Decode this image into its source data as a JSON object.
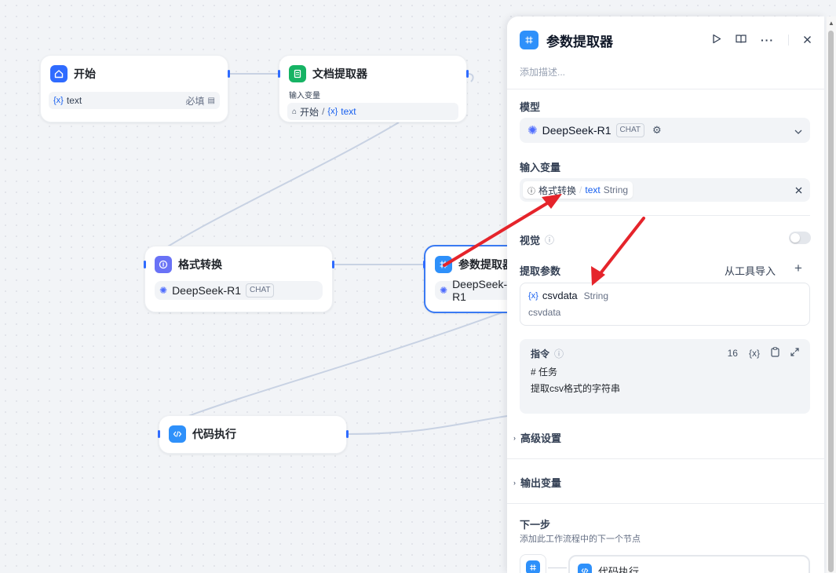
{
  "canvas": {
    "nodes": {
      "start": {
        "title": "开始",
        "var_prefix": "{x}",
        "var_name": "text",
        "required": "必填"
      },
      "doc_extractor": {
        "title": "文档提取器",
        "input_label": "输入变量",
        "source_node": "开始",
        "var_prefix": "{x}",
        "var_name": "text"
      },
      "format_convert": {
        "title": "格式转换",
        "model": "DeepSeek-R1",
        "mode": "CHAT"
      },
      "param_extractor": {
        "title": "参数提取器",
        "model": "DeepSeek-R1"
      },
      "code_exec": {
        "title": "代码执行"
      }
    }
  },
  "panel": {
    "title": "参数提取器",
    "description_placeholder": "添加描述...",
    "model_section": {
      "label": "模型",
      "model": "DeepSeek-R1",
      "mode": "CHAT"
    },
    "input_section": {
      "label": "输入变量",
      "source_node": "格式转换",
      "var_name": "text",
      "var_type": "String"
    },
    "vision_section": {
      "label": "视觉"
    },
    "extract_section": {
      "label": "提取参数",
      "import_label": "从工具导入",
      "param": {
        "prefix": "{x}",
        "name": "csvdata",
        "type": "String",
        "description": "csvdata"
      }
    },
    "instruction_section": {
      "label": "指令",
      "count": "16",
      "var_icon": "{x}",
      "line1": "# 任务",
      "line2": "提取csv格式的字符串"
    },
    "advanced_label": "高级设置",
    "output_label": "输出变量",
    "next_step": {
      "label": "下一步",
      "hint": "添加此工作流程中的下一个节点",
      "next_node": "代码执行"
    }
  },
  "colors": {
    "accent": "#2f6bff",
    "annotation_arrow": "#e5242b",
    "selected_border": "#3a7af3"
  },
  "icons": {
    "start": "home-icon",
    "doc": "document-icon",
    "format": "info-circle-icon",
    "extractor": "grid-icon",
    "code": "code-icon",
    "run": "play-icon",
    "book": "book-icon",
    "more": "more-icon",
    "close": "close-icon"
  }
}
